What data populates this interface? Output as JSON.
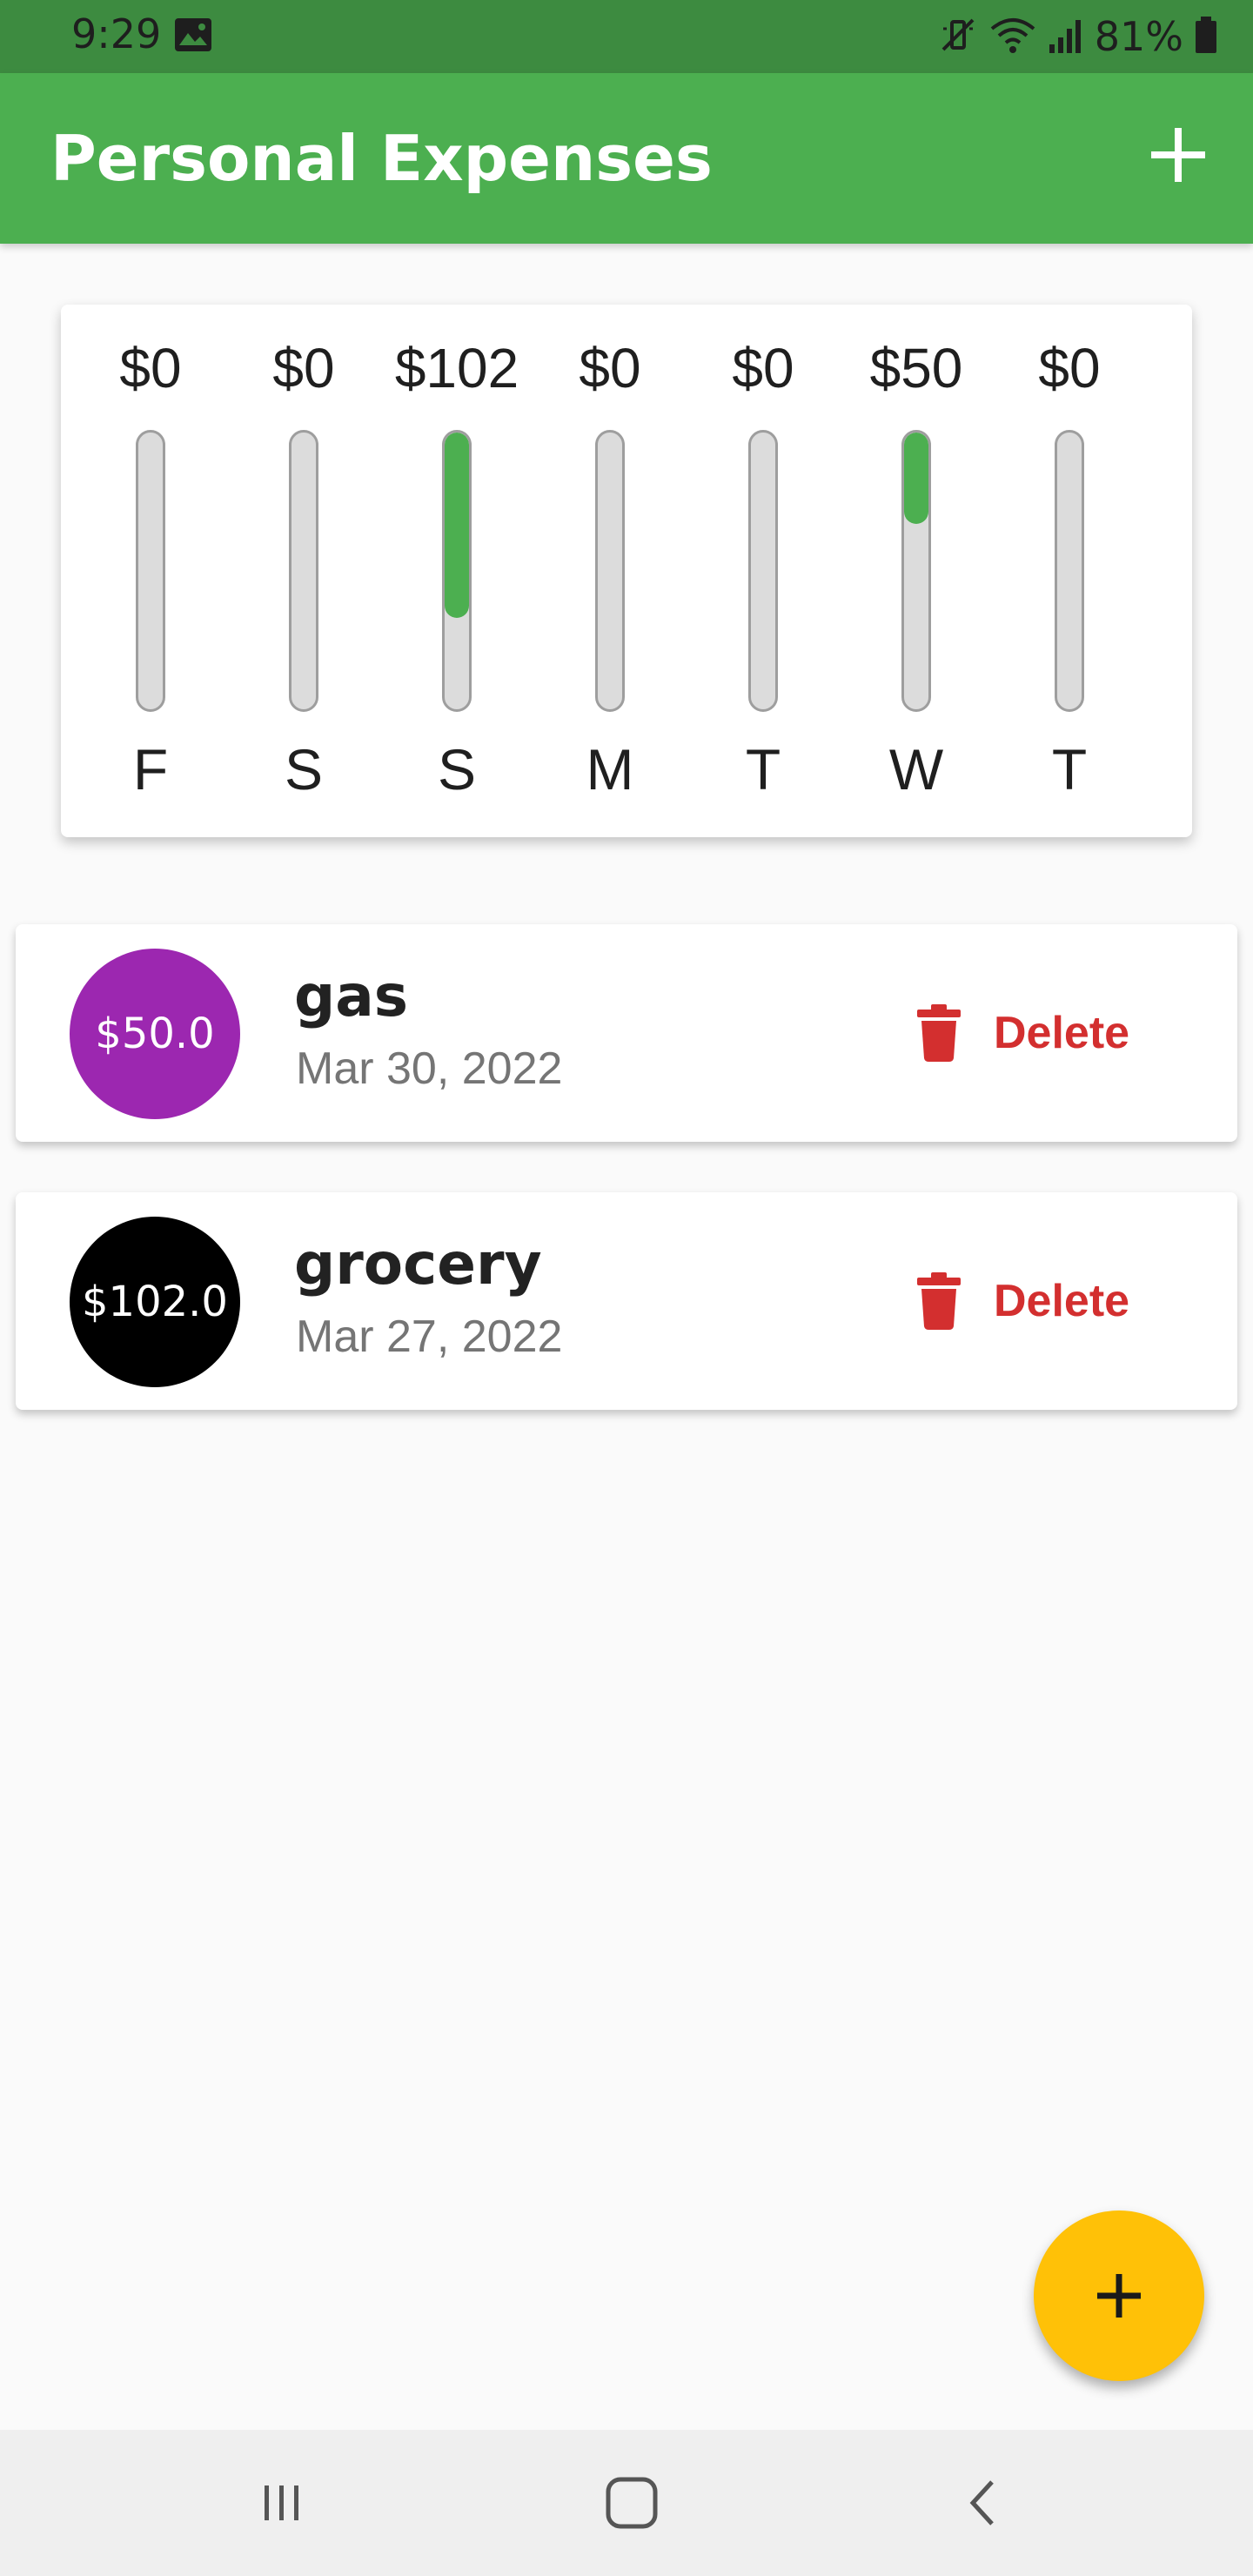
{
  "status_bar": {
    "time": "9:29",
    "battery": "81%",
    "icons": [
      "gallery-icon",
      "mute-vibrate-icon",
      "wifi-icon",
      "signal-icon",
      "battery-icon"
    ]
  },
  "app_bar": {
    "title": "Personal Expenses",
    "add_icon": "plus-icon"
  },
  "chart_data": {
    "type": "bar",
    "categories": [
      "F",
      "S",
      "S",
      "M",
      "T",
      "W",
      "T"
    ],
    "labels": [
      "$0",
      "$0",
      "$102",
      "$0",
      "$0",
      "$50",
      "$0"
    ],
    "values": [
      0,
      0,
      102,
      0,
      0,
      50,
      0
    ],
    "fill_fractions": [
      0,
      0,
      0.67,
      0,
      0,
      0.33,
      0
    ],
    "colors": {
      "fill": "#4caf50",
      "track": "#dcdcdc"
    }
  },
  "transactions": [
    {
      "amount": "$50.0",
      "title": "gas",
      "date": "Mar 30, 2022",
      "avatar_color": "#9c27b0",
      "delete_label": "Delete"
    },
    {
      "amount": "$102.0",
      "title": "grocery",
      "date": "Mar 27, 2022",
      "avatar_color": "#000000",
      "delete_label": "Delete"
    }
  ],
  "fab": {
    "icon": "plus-icon",
    "color": "#ffc107"
  },
  "nav_bar": {
    "icons": [
      "recent-apps-icon",
      "home-icon",
      "back-icon"
    ]
  },
  "colors": {
    "primary": "#4caf50",
    "primary_dark": "#3d8b40",
    "accent": "#ffc107",
    "danger": "#d32f2f"
  }
}
